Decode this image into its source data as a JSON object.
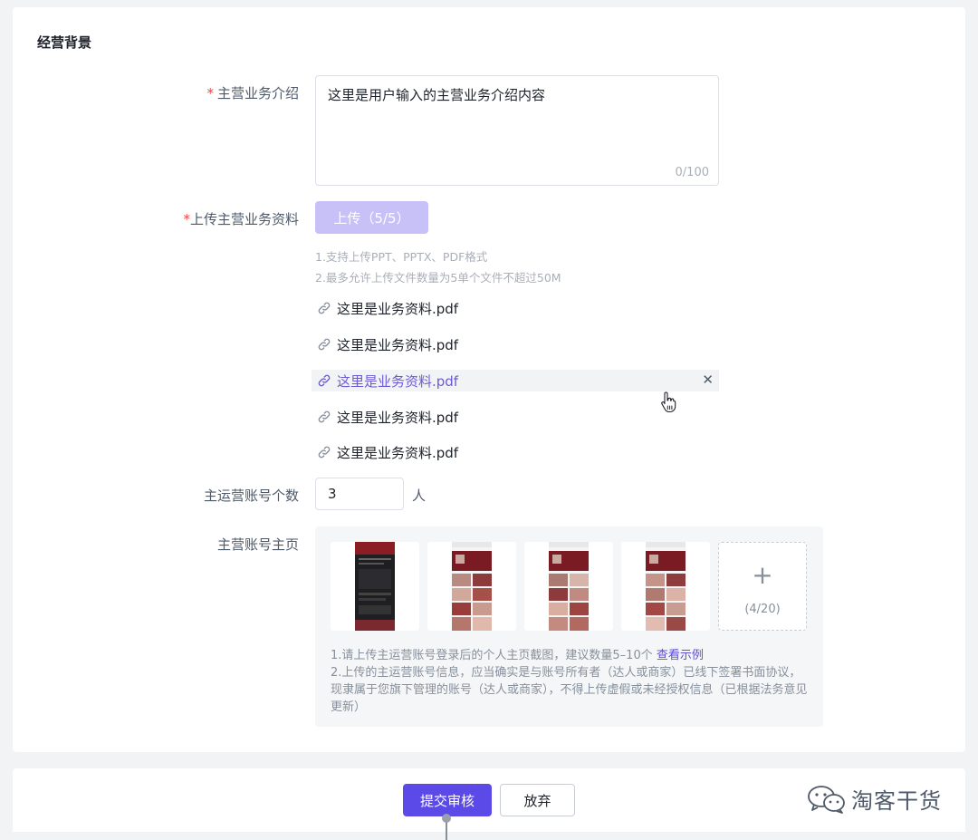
{
  "section": {
    "title": "经营背景"
  },
  "business_intro": {
    "required_mark": "*",
    "label": "主营业务介绍",
    "value": "这里是用户输入的主营业务介绍内容",
    "counter": "0/100"
  },
  "business_docs": {
    "required_mark": "*",
    "label": "上传主营业务资料",
    "upload_label": "上传（5/5）",
    "tips": [
      "1.支持上传PPT、PPTX、PDF格式",
      "2.最多允许上传文件数量为5单个文件不超过50M"
    ],
    "files": [
      {
        "name": "这里是业务资料.pdf"
      },
      {
        "name": "这里是业务资料.pdf"
      },
      {
        "name": "这里是业务资料.pdf",
        "hovered": true,
        "close_glyph": "✕"
      },
      {
        "name": "这里是业务资料.pdf"
      },
      {
        "name": "这里是业务资料.pdf"
      }
    ]
  },
  "account_count": {
    "label": "主运营账号个数",
    "value": "3",
    "unit": "人"
  },
  "account_homepage": {
    "label": "主营账号主页",
    "thumbnail_count": 4,
    "add_glyph": "+",
    "add_counter": "(4/20)",
    "note_1_text": "1.请上传主运营账号登录后的个人主页截图，建议数量5–10个 ",
    "note_1_link": "查看示例",
    "note_2_text": "2.上传的主运营账号信息，应当确实是与账号所有者（达人或商家）已线下签署书面协议，现隶属于您旗下管理的账号（达人或商家），不得上传虚假或未经授权信息（已根据法务意见更新）"
  },
  "footer": {
    "submit_label": "提交审核",
    "cancel_label": "放弃",
    "watermark": "淘客干货"
  },
  "colors": {
    "primary": "#5b49e8",
    "primary_disabled": "#c7c1f7",
    "required": "#f53f3f",
    "link": "#5b4cd4"
  }
}
